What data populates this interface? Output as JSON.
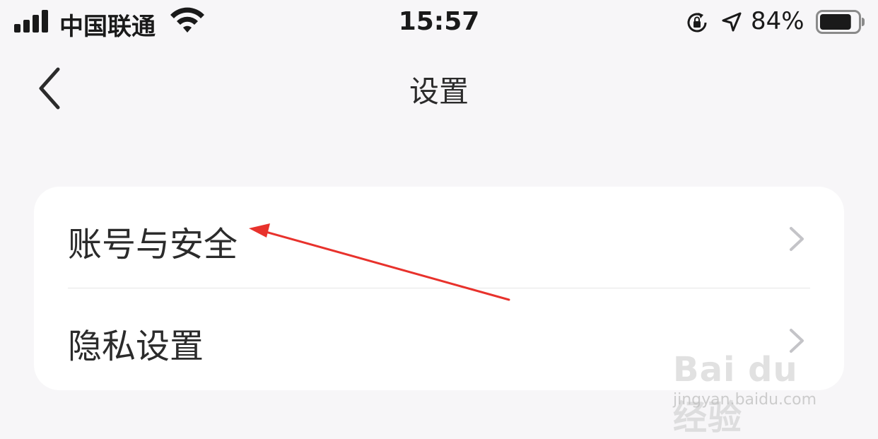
{
  "status_bar": {
    "carrier": "中国联通",
    "time": "15:57",
    "battery_percent": "84%",
    "battery_level": 0.84,
    "signal_bars": 4,
    "icons": [
      "signal-icon",
      "wifi-icon",
      "rotation-lock-icon",
      "location-icon",
      "battery-icon"
    ]
  },
  "nav": {
    "title": "设置",
    "back_icon": "chevron-left-icon"
  },
  "settings_list": {
    "items": [
      {
        "label": "账号与安全",
        "icon": "chevron-right-icon"
      },
      {
        "label": "隐私设置",
        "icon": "chevron-right-icon"
      }
    ]
  },
  "annotation": {
    "type": "red-arrow",
    "color": "#e8322c",
    "points_to": "账号与安全"
  },
  "watermark": {
    "brand": "Bai du 经验",
    "site": "jingyan.baidu.com"
  },
  "colors": {
    "background": "#f7f6f8",
    "card": "#ffffff",
    "text": "#2b2b2b",
    "chevron": "#c4c4c8",
    "arrow": "#e8322c"
  }
}
